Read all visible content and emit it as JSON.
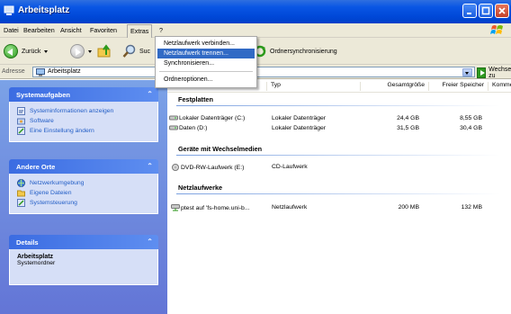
{
  "window": {
    "title": "Arbeitsplatz"
  },
  "menubar": {
    "items": [
      "Datei",
      "Bearbeiten",
      "Ansicht",
      "Favoriten",
      "Extras",
      "?"
    ]
  },
  "toolbar": {
    "back_label": "Zurück",
    "search_label": "Suc",
    "sync_label": "Ordnersynchronisierung"
  },
  "extras_menu": {
    "items": [
      "Netzlaufwerk verbinden...",
      "Netzlaufwerk trennen...",
      "Synchronisieren...",
      "Ordneroptionen..."
    ],
    "highlighted": "Netzlaufwerk trennen..."
  },
  "address": {
    "label": "Adresse",
    "value": "Arbeitsplatz",
    "go_label": "Wechseln zu"
  },
  "taskpane": {
    "system": {
      "title": "Systemaufgaben",
      "items": [
        "Systeminformationen anzeigen",
        "Software",
        "Eine Einstellung ändern"
      ]
    },
    "places": {
      "title": "Andere Orte",
      "items": [
        "Netzwerkumgebung",
        "Eigene Dateien",
        "Systemsteuerung"
      ]
    },
    "details": {
      "title": "Details",
      "name": "Arbeitsplatz",
      "kind": "Systemordner"
    }
  },
  "columns": {
    "type": "Typ",
    "total": "Gesamtgröße",
    "free": "Freier Speicher",
    "comment": "Komme"
  },
  "groups": {
    "hdd": {
      "title": "Festplatten",
      "rows": [
        {
          "name": "Lokaler Datenträger (C:)",
          "type": "Lokaler Datenträger",
          "total": "24,4 GB",
          "free": "8,55 GB"
        },
        {
          "name": "Daten (D:)",
          "type": "Lokaler Datenträger",
          "total": "31,5 GB",
          "free": "30,4 GB"
        }
      ]
    },
    "removable": {
      "title": "Geräte mit Wechselmedien",
      "rows": [
        {
          "name": "DVD-RW-Laufwerk (E:)",
          "type": "CD-Laufwerk"
        }
      ]
    },
    "network": {
      "title": "Netzlaufwerke",
      "rows": [
        {
          "name": "ptest auf 'fs-home.uni-b...",
          "type": "Netzlaufwerk",
          "total": "200 MB",
          "free": "132 MB"
        }
      ]
    }
  },
  "colors": {
    "titlebar": "#0a56e4",
    "taskpane": "#7ba2e7",
    "link": "#215dc6",
    "highlight": "#316ac5"
  }
}
